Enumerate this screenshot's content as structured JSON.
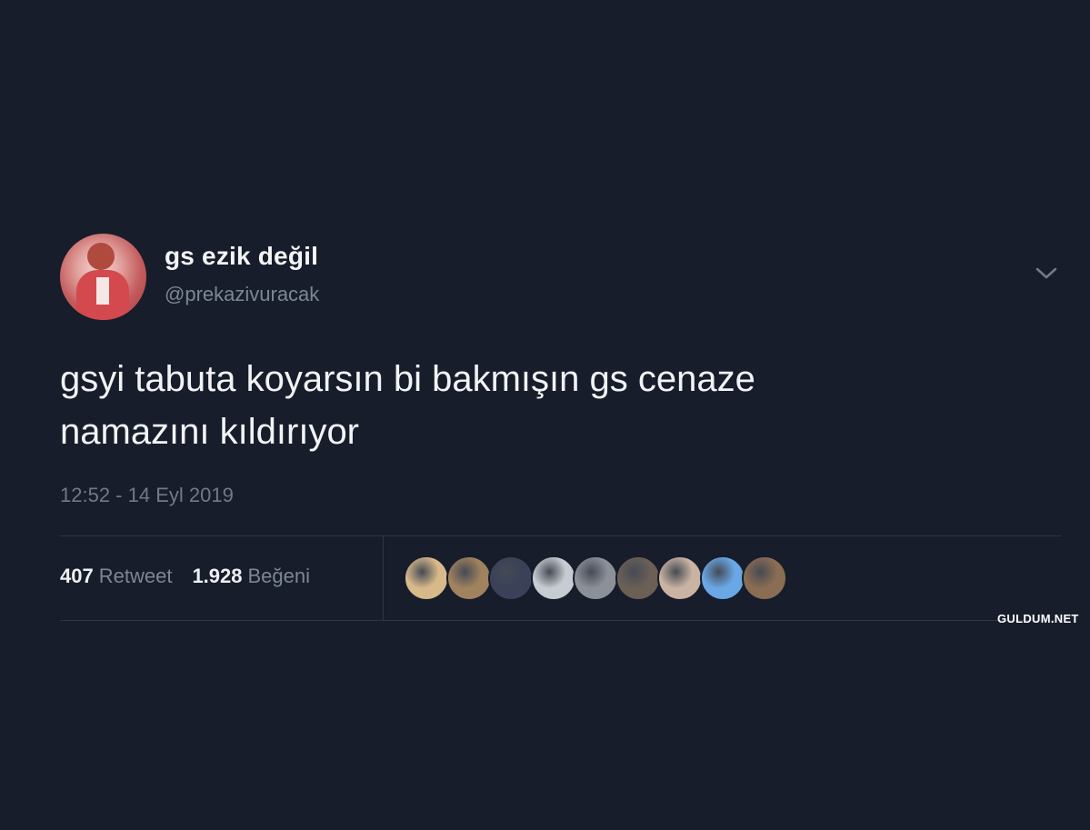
{
  "tweet": {
    "display_name": "gs ezik değil",
    "handle": "@prekazivuracak",
    "text": "gsyi tabuta koyarsın bi bakmışın gs cenaze\nnamazını kıldırıyor",
    "timestamp": "12:52 - 14 Eyl 2019",
    "menu_icon": "chevron-down-icon",
    "stats": {
      "retweets_count": "407",
      "retweets_label": "Retweet",
      "likes_count": "1.928",
      "likes_label": "Beğeni"
    },
    "likers": [
      {
        "name": "liker-1",
        "color": "#d8b98a"
      },
      {
        "name": "liker-2",
        "color": "#a0825e"
      },
      {
        "name": "liker-3",
        "color": "#3a4158"
      },
      {
        "name": "liker-4",
        "color": "#c7ccd2"
      },
      {
        "name": "liker-5",
        "color": "#8b9099"
      },
      {
        "name": "liker-6",
        "color": "#6b5f56"
      },
      {
        "name": "liker-7",
        "color": "#c9b3a2"
      },
      {
        "name": "liker-8",
        "color": "#6aa7e6"
      },
      {
        "name": "liker-9",
        "color": "#8a6d52"
      }
    ]
  },
  "watermark": "GULDUM.NET",
  "colors": {
    "background": "#171d2a",
    "text_primary": "#f2f3f5",
    "text_secondary": "#7c8792",
    "divider": "#2d3642"
  }
}
